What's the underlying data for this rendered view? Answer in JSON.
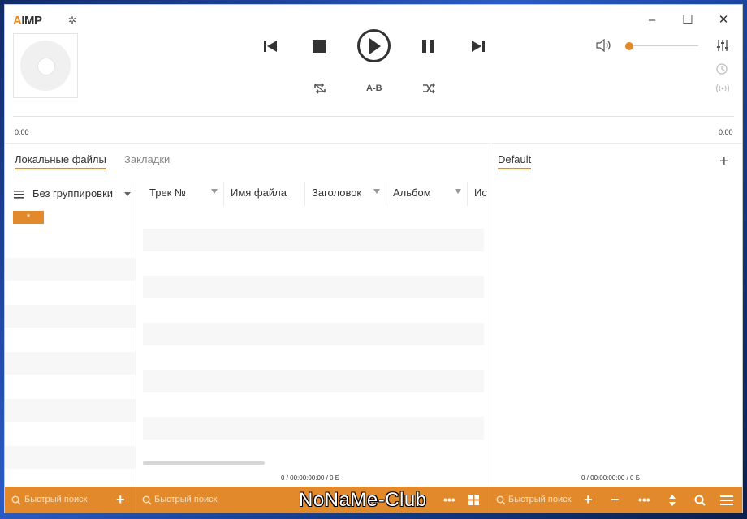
{
  "app": {
    "logo_prefix": "A",
    "logo_text": "IMP"
  },
  "player": {
    "time_elapsed": "0:00",
    "time_total": "0:00",
    "ab_label": "A-B",
    "volume_fraction": 0.05
  },
  "tabs": {
    "local_files": "Локальные файлы",
    "bookmarks": "Закладки",
    "playlist": "Default"
  },
  "library": {
    "grouping_label": "Без группировки",
    "group_item": "*",
    "columns": [
      "Трек №",
      "Имя файла",
      "Заголовок",
      "Альбом",
      "Ис"
    ],
    "summary_left": "0 / 00:00:00:00 / 0 Б",
    "summary_right": "0 / 00:00:00:00 / 0 Б"
  },
  "bottom": {
    "search_placeholder_1": "Быстрый поиск",
    "search_placeholder_2": "Быстрый поиск",
    "search_placeholder_3": "Быстрый поиск"
  },
  "watermark": "NoNaMe-Club",
  "colors": {
    "accent": "#e28a2b",
    "text": "#333333"
  }
}
